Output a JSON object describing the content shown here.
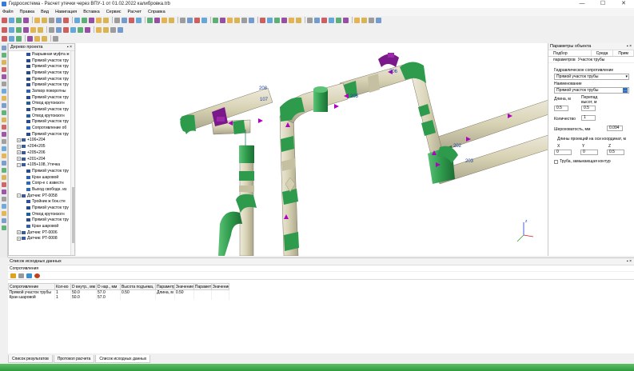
{
  "window": {
    "title": "Гидросистема - Расчет утечки через ВПУ-1 от 01.02.2022 калибровка.trb"
  },
  "menu": [
    "Файл",
    "Правка",
    "Вид",
    "Навигация",
    "Вставка",
    "Сервис",
    "Расчет",
    "Справка"
  ],
  "tree": {
    "title": "Дерево проекта",
    "items": [
      {
        "label": "Разрывная муфта ж",
        "indent": 3,
        "icon": "fitting",
        "exp": ""
      },
      {
        "label": "Прямой участок тру",
        "indent": 3,
        "icon": "pipe",
        "exp": ""
      },
      {
        "label": "Прямой участок тру",
        "indent": 3,
        "icon": "pipe",
        "exp": ""
      },
      {
        "label": "Прямой участок тру",
        "indent": 3,
        "icon": "pipe",
        "exp": ""
      },
      {
        "label": "Прямой участок тру",
        "indent": 3,
        "icon": "pipe",
        "exp": ""
      },
      {
        "label": "Прямой участок тру",
        "indent": 3,
        "icon": "pipe",
        "exp": ""
      },
      {
        "label": "Затвор поворотны",
        "indent": 3,
        "icon": "valve",
        "exp": ""
      },
      {
        "label": "Прямой участок тру",
        "indent": 3,
        "icon": "pipe",
        "exp": ""
      },
      {
        "label": "Отвод крутоизогн",
        "indent": 3,
        "icon": "bend",
        "exp": ""
      },
      {
        "label": "Прямой участок тру",
        "indent": 3,
        "icon": "pipe",
        "exp": ""
      },
      {
        "label": "Отвод крутоизогн",
        "indent": 3,
        "icon": "bend",
        "exp": ""
      },
      {
        "label": "Прямой участок тру",
        "indent": 3,
        "icon": "pipe",
        "exp": ""
      },
      {
        "label": "Сопротивление об",
        "indent": 3,
        "icon": "res",
        "exp": ""
      },
      {
        "label": "Прямой участок тру",
        "indent": 3,
        "icon": "pipe",
        "exp": ""
      },
      {
        "label": "+106+204",
        "indent": 1,
        "icon": "node",
        "exp": "+"
      },
      {
        "label": "+204+205",
        "indent": 1,
        "icon": "node",
        "exp": "+"
      },
      {
        "label": "+205+206",
        "indent": 1,
        "icon": "node",
        "exp": "+"
      },
      {
        "label": "+201+204",
        "indent": 1,
        "icon": "node",
        "exp": "+"
      },
      {
        "label": "+105+108, Утечка",
        "indent": 1,
        "icon": "node",
        "exp": "−"
      },
      {
        "label": "Прямой участок тру",
        "indent": 3,
        "icon": "pipe",
        "exp": ""
      },
      {
        "label": "Кран шаровой",
        "indent": 3,
        "icon": "valve",
        "exp": ""
      },
      {
        "label": "Сопр-е с известн",
        "indent": 3,
        "icon": "res",
        "exp": ""
      },
      {
        "label": "Выход свободн. из",
        "indent": 3,
        "icon": "res",
        "exp": ""
      },
      {
        "label": "Датчик: PT-0058",
        "indent": 1,
        "icon": "node",
        "exp": "−"
      },
      {
        "label": "Тройник ж бок.сте",
        "indent": 3,
        "icon": "fitting",
        "exp": ""
      },
      {
        "label": "Прямой участок тру",
        "indent": 3,
        "icon": "pipe",
        "exp": ""
      },
      {
        "label": "Отвод крутоизогн",
        "indent": 3,
        "icon": "bend",
        "exp": ""
      },
      {
        "label": "Прямой участок тру",
        "indent": 3,
        "icon": "pipe",
        "exp": ""
      },
      {
        "label": "Кран шаровой",
        "indent": 3,
        "icon": "valve",
        "exp": ""
      },
      {
        "label": "Датчик: PT-0006",
        "indent": 1,
        "icon": "node",
        "exp": "+"
      },
      {
        "label": "Датчик: PT-0008",
        "indent": 1,
        "icon": "node",
        "exp": "+"
      }
    ]
  },
  "viewport": {
    "labels": [
      "208",
      "107",
      "205",
      "202",
      "203",
      "206"
    ]
  },
  "props": {
    "title": "Параметры объекта",
    "tabs": [
      "Подбор параметров",
      "Среда",
      "Прим"
    ],
    "section": "Участок трубы",
    "hydraulic_label": "Гидравлическое сопротивление",
    "hydraulic_value": "Прямой участок трубы",
    "name_label": "Наименование",
    "name_value": "Прямой участок трубы",
    "length_label": "Длина, м",
    "length_value": "0.5",
    "drop_label": "Перепад высот, м",
    "drop_value": "0.5",
    "qty_label": "Количество",
    "qty_value": "1",
    "rough_label": "Шероховатость, мм",
    "rough_value": "0.094",
    "proj_label": "Длины проекций на оси координат, м",
    "x_label": "X",
    "y_label": "Y",
    "z_label": "Z",
    "x_value": "0",
    "y_value": "0",
    "z_value": "0.5",
    "closing_label": "Труба, замыкающая контур"
  },
  "bottom": {
    "title": "Список исходных данных",
    "sub": "Сопротивления",
    "columns": [
      "Сопротивление",
      "Кол-во",
      "D внутр., мм",
      "D нар., мм",
      "Высота подъема, м",
      "Параметр 1",
      "Значение 1",
      "Параметр 2",
      "Значение 2"
    ],
    "rows": [
      [
        "Прямой участок трубы",
        "1",
        "50.0",
        "57.0",
        "0.50",
        "Длина, м",
        "0.50",
        "",
        ""
      ],
      [
        "Кран шаровой",
        "1",
        "50.0",
        "57.0",
        "",
        "",
        "",
        "",
        ""
      ]
    ]
  },
  "bottom_tabs": [
    "Список результатов",
    "Протокол расчета",
    "Список исходных данных"
  ],
  "colors": {
    "pipe_beige": "#d8d2b4",
    "pipe_green": "#2e9a4c",
    "arrow": "#b000c0",
    "valve": "#7a1a8a",
    "status": "#3aa64a"
  }
}
